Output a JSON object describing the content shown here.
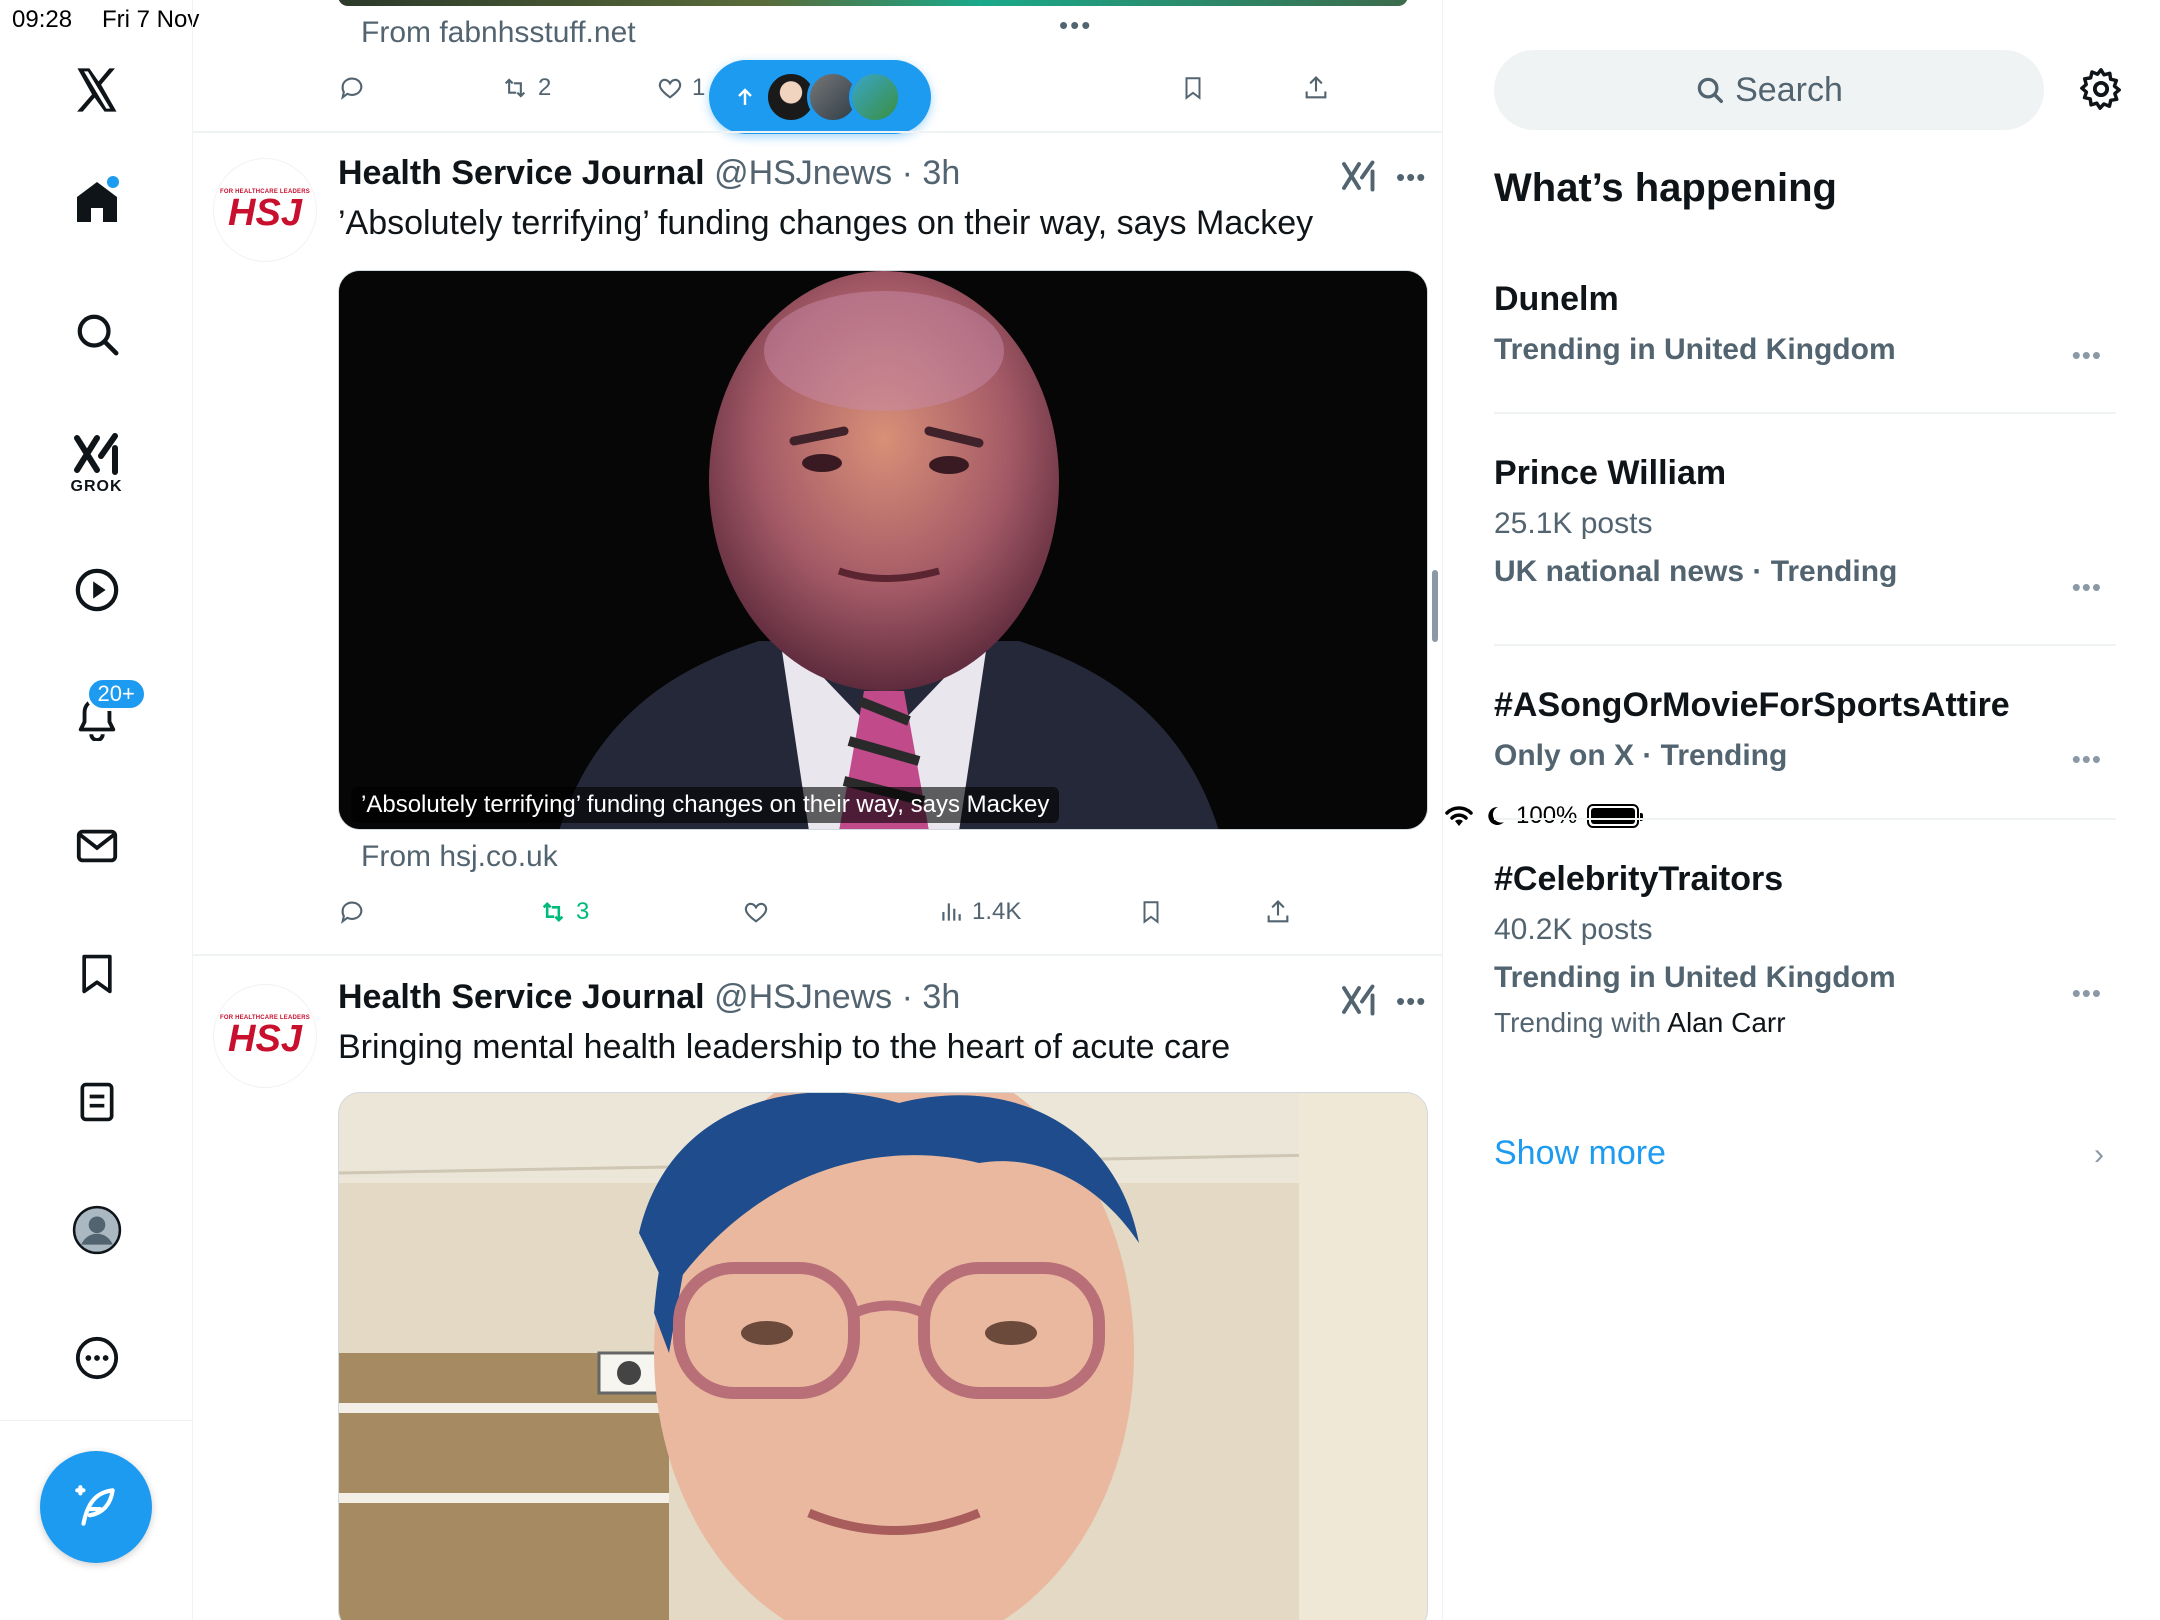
{
  "status": {
    "time": "09:28",
    "date": "Fri 7 Nov",
    "battery": "100%"
  },
  "nav": {
    "notifications_badge": "20+",
    "grok_label": "GROK"
  },
  "feed": {
    "prev_tweet": {
      "from": "From fabnhsstuff.net",
      "retweets": "2",
      "likes": "1"
    },
    "tweets": [
      {
        "name": "Health Service Journal",
        "handle": "@HSJnews",
        "time": "3h",
        "text": "’Absolutely terrifying’ funding changes on their way, says Mackey",
        "caption": "’Absolutely terrifying’ funding changes on their way, says Mackey",
        "from": "From hsj.co.uk",
        "retweets": "3",
        "views": "1.4K"
      },
      {
        "name": "Health Service Journal",
        "handle": "@HSJnews",
        "time": "3h",
        "text": "Bringing mental health leadership to the heart of acute care"
      }
    ],
    "avatar_text": {
      "small": "FOR HEALTHCARE LEADERS",
      "big": "HSJ"
    }
  },
  "right": {
    "search_placeholder": "Search",
    "section_title": "What’s happening",
    "trends": [
      {
        "name": "Dunelm",
        "context": "Trending in United Kingdom"
      },
      {
        "name": "Prince William",
        "posts": "25.1K posts",
        "context": "UK national news · Trending"
      },
      {
        "name": "#ASongOrMovieForSportsAttire",
        "context": "Only on X · Trending"
      },
      {
        "name": "#CelebrityTraitors",
        "posts": "40.2K posts",
        "context": "Trending in United Kingdom",
        "with_prefix": "Trending with",
        "with_name": "Alan Carr"
      }
    ],
    "show_more": "Show more"
  },
  "colors": {
    "accent": "#1d9bf0",
    "retweet": "#00ba7c",
    "muted": "#536471",
    "hsj_red": "#c8102e"
  }
}
